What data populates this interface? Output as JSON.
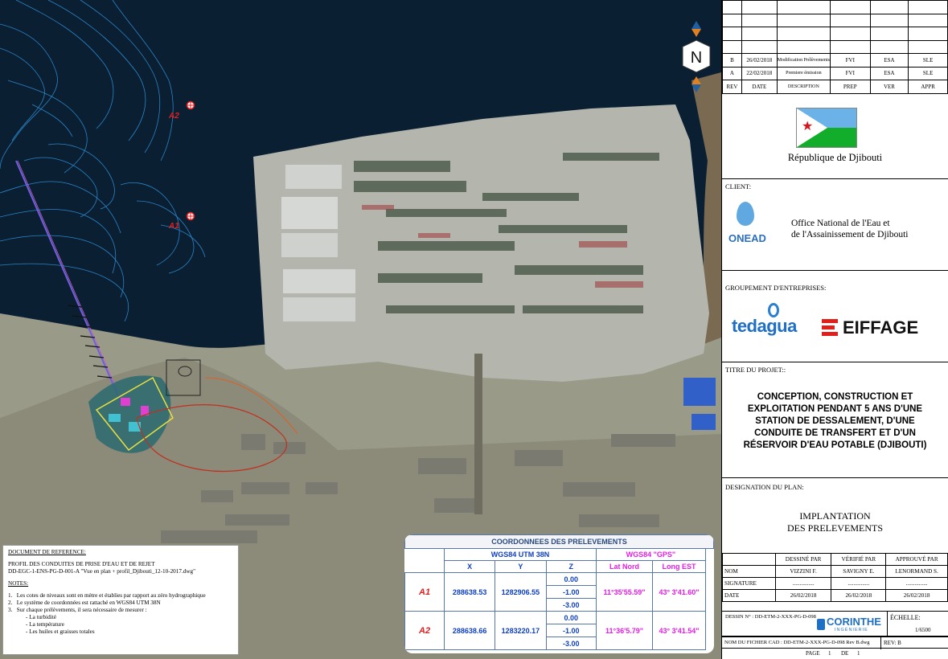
{
  "north_label": "N",
  "markers": [
    {
      "label": "A2"
    },
    {
      "label": "A1"
    }
  ],
  "revisions": [
    {
      "rev": "",
      "date": "",
      "desc": "",
      "prep": "",
      "ver": "",
      "appr": ""
    },
    {
      "rev": "",
      "date": "",
      "desc": "",
      "prep": "",
      "ver": "",
      "appr": ""
    },
    {
      "rev": "",
      "date": "",
      "desc": "",
      "prep": "",
      "ver": "",
      "appr": ""
    },
    {
      "rev": "",
      "date": "",
      "desc": "",
      "prep": "",
      "ver": "",
      "appr": ""
    },
    {
      "rev": "B",
      "date": "26/02/2018",
      "desc": "Modification Prélèvements",
      "prep": "FVI",
      "ver": "ESA",
      "appr": "SLE"
    },
    {
      "rev": "A",
      "date": "22/02/2018",
      "desc": "Premiere émission",
      "prep": "FVI",
      "ver": "ESA",
      "appr": "SLE"
    },
    {
      "rev": "REV",
      "date": "DATE",
      "desc": "DESCRIPTION",
      "prep": "PREP",
      "ver": "VER",
      "appr": "APPR"
    }
  ],
  "country": "République de Djibouti",
  "client": {
    "label": "CLIENT:",
    "logo_text": "ONEAD",
    "name_line1": "Office National de l'Eau et",
    "name_line2": "de l'Assainissement de Djibouti"
  },
  "group": {
    "label": "GROUPEMENT D'ENTREPRISES:",
    "company1": "tedagua",
    "company2": "EIFFAGE"
  },
  "project": {
    "label": "TITRE DU PROJET::",
    "line1": "CONCEPTION, CONSTRUCTION ET",
    "line2": "EXPLOITATION PENDANT 5 ANS D'UNE",
    "line3": "STATION DE DESSALEMENT, D'UNE",
    "line4": "CONDUITE DE TRANSFERT ET D'UN",
    "line5": "RÉSERVOIR D'EAU POTABLE (DJIBOUTI)"
  },
  "plan": {
    "label": "DESIGNATION DU PLAN:",
    "line1": "IMPLANTATION",
    "line2": "DES PRELEVEMENTS"
  },
  "signatures": {
    "h_drawn": "DESSINÉ PAR",
    "h_verified": "VÉRIFIÉ PAR",
    "h_approved": "APPROUVÉ PAR",
    "nom": "NOM",
    "drawn": "VIZZINI F.",
    "verified": "SAVIGNY E.",
    "approved": "LENORMAND S.",
    "signature": "SIGNATURE",
    "dots": "...............",
    "date": "DATE",
    "date_val": "26/02/2018"
  },
  "dessin": {
    "label": "DESSIN N° : DD-ETM-2-XXX-PG-D-098",
    "logo": "CORINTHE",
    "logo_sub": "INGÉNIERIE",
    "echelle_label": "ÉCHELLE:",
    "echelle": "1/6500"
  },
  "fichier": {
    "label": "NOM DU FICHIER CAD : DD-ETM-2-XXX-PG-D-098 Rev B.dwg",
    "rev": "REV: B"
  },
  "page": {
    "label": "PAGE",
    "num": "1",
    "de": "DE",
    "total": "1"
  },
  "reference": {
    "title": "DOCUMENT DE REFERENCE:",
    "line1": "PROFIL DES CONDUITES DE PRISE D'EAU ET DE REJET",
    "line2": "DD-EGC-1-ENS-PG-D-001-A \"Vue en plan + profil_Djibouti_12-10-2017.dwg\"",
    "notes_title": "NOTES:",
    "n1": "Les cotes de niveaux sont en mètre et établies par rapport au zéro hydrographique",
    "n2": "Le système de coordonnées est rattaché en WGS84 UTM 38N",
    "n3": "Sur chaque prélèvements, il sera nécessaire de mesurer :",
    "b1": "- La turbidité",
    "b2": "- La température",
    "b3": "- Les huiles et graisses totales"
  },
  "coords": {
    "title": "COORDONNEES DES PRELEVEMENTS",
    "utm": "WGS84 UTM 38N",
    "gps": "WGS84 \"GPS\"",
    "hx": "X",
    "hy": "Y",
    "hz": "Z",
    "hlat": "Lat Nord",
    "hlon": "Long EST",
    "rows": [
      {
        "id": "A1",
        "x": "288638.53",
        "y": "1282906.55",
        "z": [
          "0.00",
          "-1.00",
          "-3.00"
        ],
        "lat": "11°35'55.59\"",
        "lon": "43° 3'41.60\""
      },
      {
        "id": "A2",
        "x": "288638.66",
        "y": "1283220.17",
        "z": [
          "0.00",
          "-1.00",
          "-3.00"
        ],
        "lat": "11°36'5.79\"",
        "lon": "43° 3'41.54\""
      }
    ]
  }
}
